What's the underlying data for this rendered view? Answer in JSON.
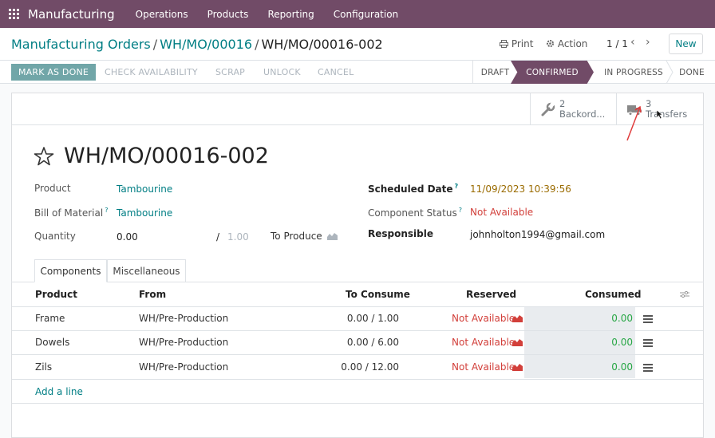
{
  "navbar": {
    "app_name": "Manufacturing",
    "menu": [
      "Operations",
      "Products",
      "Reporting",
      "Configuration"
    ]
  },
  "control_panel": {
    "breadcrumb": [
      "Manufacturing Orders",
      "WH/MO/00016",
      "WH/MO/00016-002"
    ],
    "print_label": "Print",
    "action_label": "Action",
    "pager": "1 / 1",
    "new_label": "New"
  },
  "status_bar": {
    "mark_done": "MARK AS DONE",
    "check_availability": "CHECK AVAILABILITY",
    "scrap": "SCRAP",
    "unlock": "UNLOCK",
    "cancel": "CANCEL",
    "stages": [
      "DRAFT",
      "CONFIRMED",
      "IN PROGRESS",
      "DONE"
    ],
    "active_stage": "CONFIRMED"
  },
  "smart_buttons": {
    "backorders_count": "2",
    "backorders_label": "Backord...",
    "transfers_count": "3",
    "transfers_label": "Transfers"
  },
  "record": {
    "title": "WH/MO/00016-002",
    "product_label": "Product",
    "product_value": "Tambourine",
    "bom_label": "Bill of Material",
    "bom_value": "Tambourine",
    "quantity_label": "Quantity",
    "quantity_value": "0.00",
    "quantity_slash": "/",
    "quantity_total": "1.00",
    "to_produce_label": "To Produce",
    "scheduled_label": "Scheduled Date",
    "scheduled_value": "11/09/2023 10:39:56",
    "component_status_label": "Component Status",
    "component_status_value": "Not Available",
    "responsible_label": "Responsible",
    "responsible_value": "johnholton1994@gmail.com",
    "help_mark": "?"
  },
  "tabs": [
    "Components",
    "Miscellaneous"
  ],
  "components": {
    "headers": [
      "Product",
      "From",
      "To Consume",
      "Reserved",
      "Consumed"
    ],
    "rows": [
      {
        "product": "Frame",
        "from": "WH/Pre-Production",
        "to_consume": "0.00 /  1.00",
        "reserved": "Not Available",
        "consumed": "0.00"
      },
      {
        "product": "Dowels",
        "from": "WH/Pre-Production",
        "to_consume": "0.00 /  6.00",
        "reserved": "Not Available",
        "consumed": "0.00"
      },
      {
        "product": "Zils",
        "from": "WH/Pre-Production",
        "to_consume": "0.00 /  12.00",
        "reserved": "Not Available",
        "consumed": "0.00"
      }
    ],
    "add_line": "Add a line"
  },
  "colors": {
    "brand": "#714b67",
    "link": "#017e84",
    "danger": "#d23f3a",
    "success": "#28a745"
  }
}
